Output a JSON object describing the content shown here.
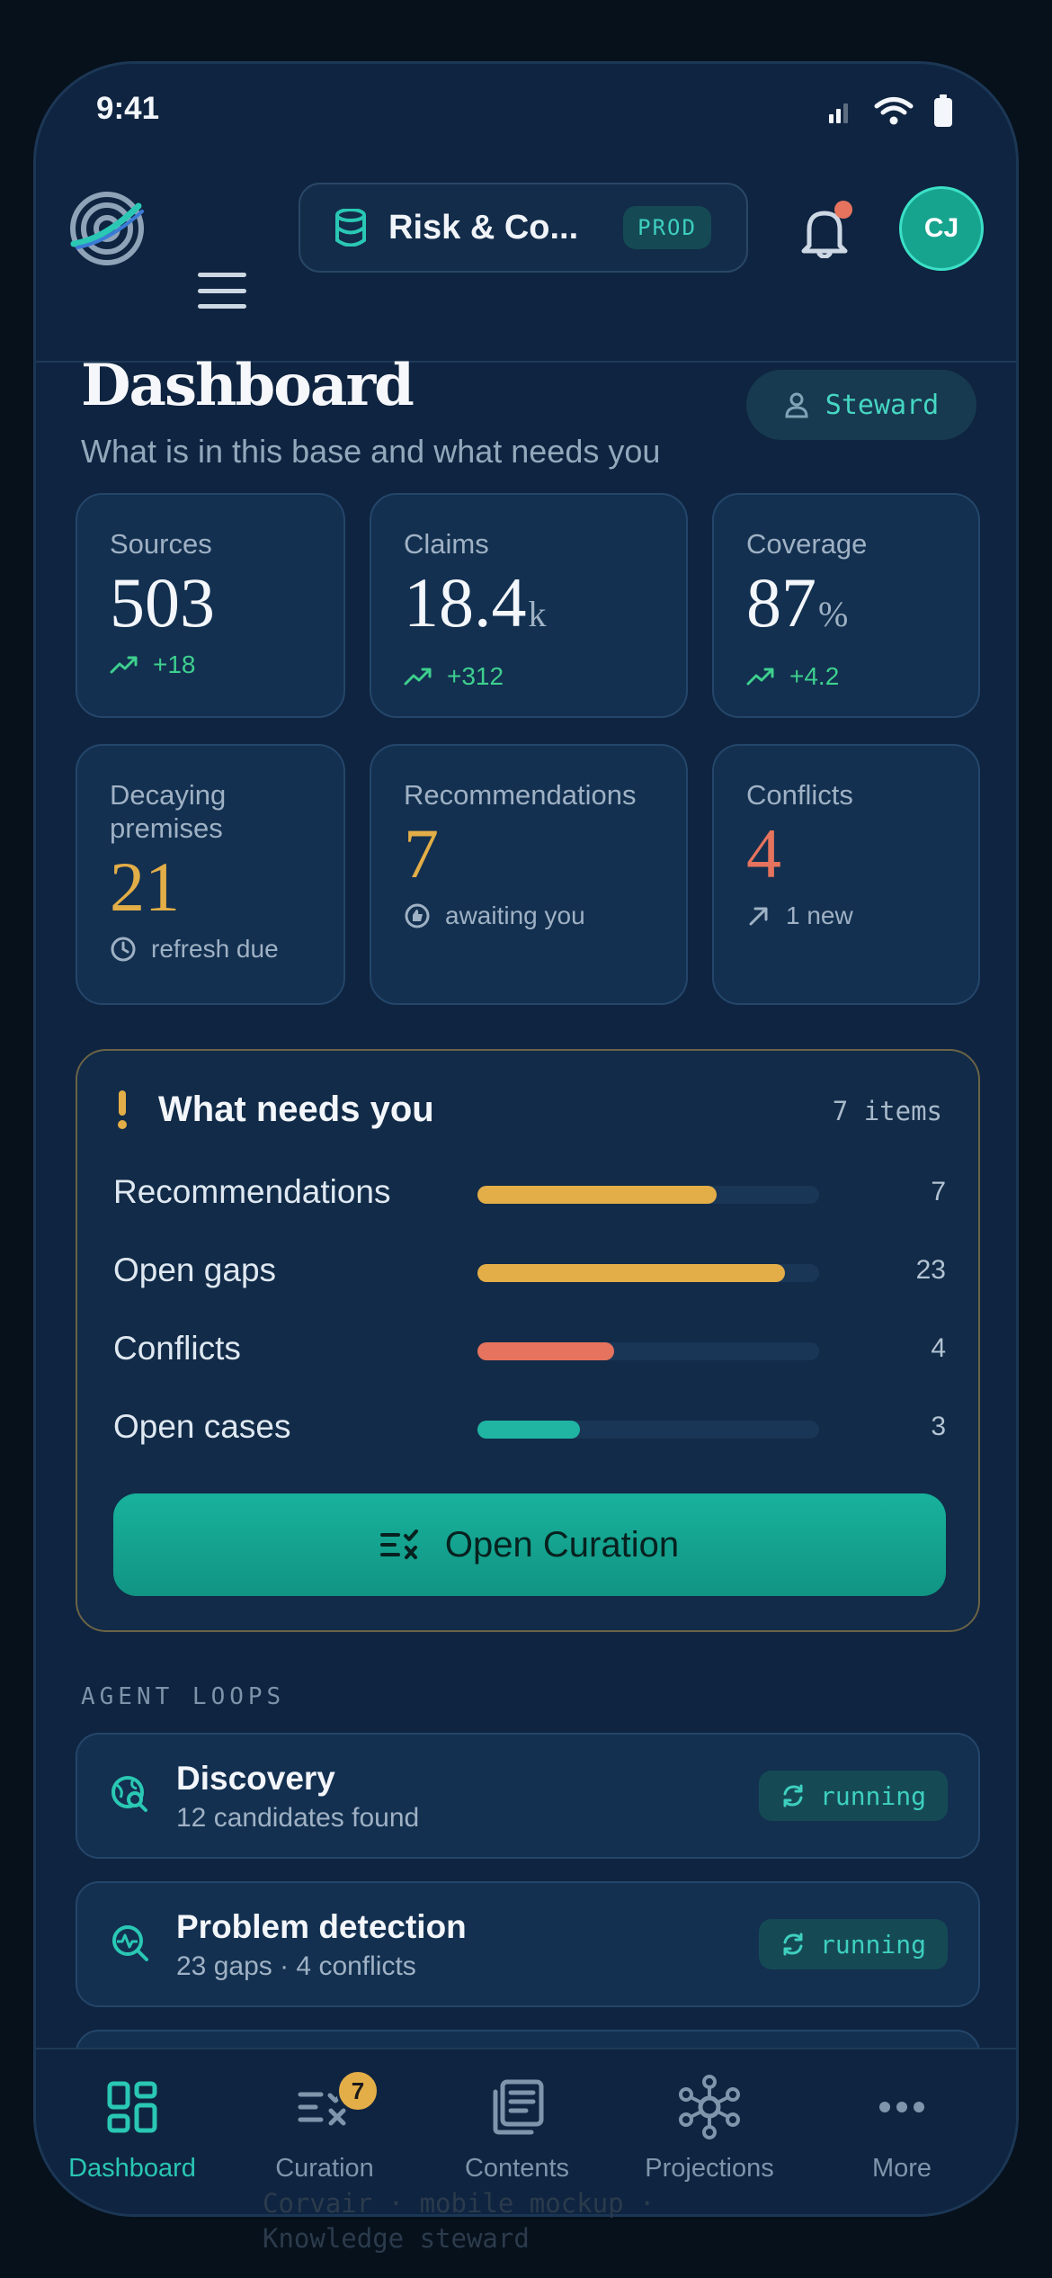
{
  "status_bar": {
    "time": "9:41"
  },
  "topbar": {
    "workspace_name": "Risk & Co...",
    "environment_badge": "PROD",
    "avatar_initials": "CJ"
  },
  "header": {
    "title": "Dashboard",
    "subtitle": "What is in this base and what needs you",
    "role": "Steward"
  },
  "stats": [
    {
      "label": "Sources",
      "value": "503",
      "unit": "",
      "delta": "+18",
      "delta_icon": "trend-up-icon"
    },
    {
      "label": "Claims",
      "value": "18.4",
      "unit": "k",
      "delta": "+312",
      "delta_icon": "trend-up-icon"
    },
    {
      "label": "Coverage",
      "value": "87",
      "unit": "%",
      "delta": "+4.2",
      "delta_icon": "trend-up-icon"
    },
    {
      "label": "Decaying premises",
      "value": "21",
      "unit": "",
      "delta": "refresh due",
      "delta_icon": "clock-icon"
    },
    {
      "label": "Recommendations",
      "value": "7",
      "unit": "",
      "delta": "awaiting you",
      "delta_icon": "thumb-icon"
    },
    {
      "label": "Conflicts",
      "value": "4",
      "unit": "",
      "delta": "1 new",
      "delta_icon": "arrow-up-right-icon"
    }
  ],
  "needs": {
    "title": "What needs you",
    "count": "7 items",
    "rows": [
      {
        "label": "Recommendations",
        "count": "7",
        "fill": 0.7,
        "color": "#e3ae47"
      },
      {
        "label": "Open gaps",
        "count": "23",
        "fill": 0.9,
        "color": "#e3ae47"
      },
      {
        "label": "Conflicts",
        "count": "4",
        "fill": 0.4,
        "color": "#e5735d"
      },
      {
        "label": "Open cases",
        "count": "3",
        "fill": 0.3,
        "color": "#1fb5a2"
      }
    ],
    "cta_label": "Open Curation"
  },
  "agent_loops": {
    "section_label": "AGENT LOOPS",
    "items": [
      {
        "title": "Discovery",
        "detail": "12 candidates found",
        "status": "running",
        "icon": "globe-search-icon"
      },
      {
        "title": "Problem detection",
        "detail": "23 gaps · 4 conflicts",
        "status": "running",
        "icon": "pulse-search-icon"
      }
    ]
  },
  "bottom_nav": {
    "items": [
      {
        "label": "Dashboard",
        "icon": "dashboard-icon",
        "active": true
      },
      {
        "label": "Curation",
        "icon": "curation-icon",
        "badge": "7"
      },
      {
        "label": "Contents",
        "icon": "contents-icon"
      },
      {
        "label": "Projections",
        "icon": "projections-icon"
      },
      {
        "label": "More",
        "icon": "more-icon"
      }
    ]
  },
  "footer": {
    "line1": "Corvair · mobile mockup ·",
    "line2": "Knowledge steward"
  },
  "colors": {
    "accent_teal": "#1fb5a2",
    "amber": "#e3ae47",
    "coral": "#e5735d",
    "positive_green": "#3ecf8e"
  }
}
